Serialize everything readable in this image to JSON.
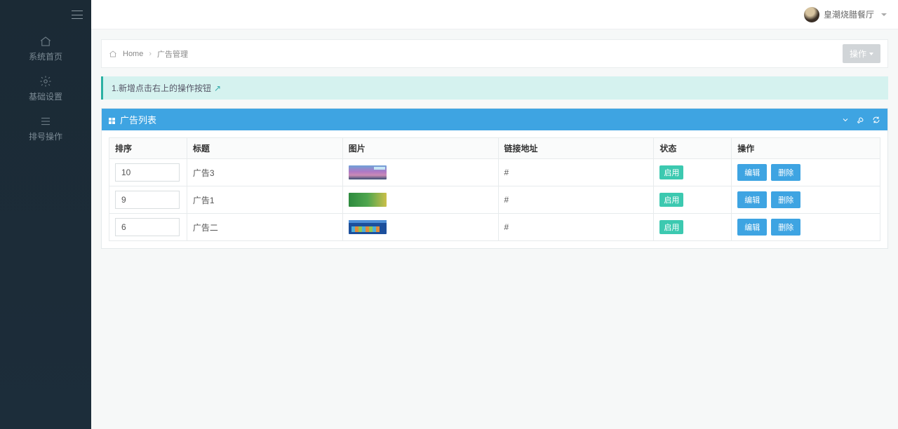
{
  "user": {
    "name": "皇潮烧腊餐厅"
  },
  "sidebar": {
    "items": [
      {
        "label": "系统首页"
      },
      {
        "label": "基础设置"
      },
      {
        "label": "排号操作"
      }
    ]
  },
  "breadcrumb": {
    "home": "Home",
    "current": "广告管理"
  },
  "action_menu": {
    "label": "操作"
  },
  "tip": {
    "text": "1.新增点击右上的操作按钮",
    "arrow": "↗"
  },
  "panel": {
    "title": "广告列表"
  },
  "table": {
    "headers": {
      "sort": "排序",
      "title": "标题",
      "image": "图片",
      "link": "链接地址",
      "status": "状态",
      "operate": "操作"
    },
    "buttons": {
      "edit": "编辑",
      "delete": "删除"
    },
    "status_label": "启用",
    "rows": [
      {
        "sort": "10",
        "title": "广告3",
        "thumb": "a",
        "link": "#",
        "status": "启用"
      },
      {
        "sort": "9",
        "title": "广告1",
        "thumb": "b",
        "link": "#",
        "status": "启用"
      },
      {
        "sort": "6",
        "title": "广告二",
        "thumb": "c",
        "link": "#",
        "status": "启用"
      }
    ]
  }
}
